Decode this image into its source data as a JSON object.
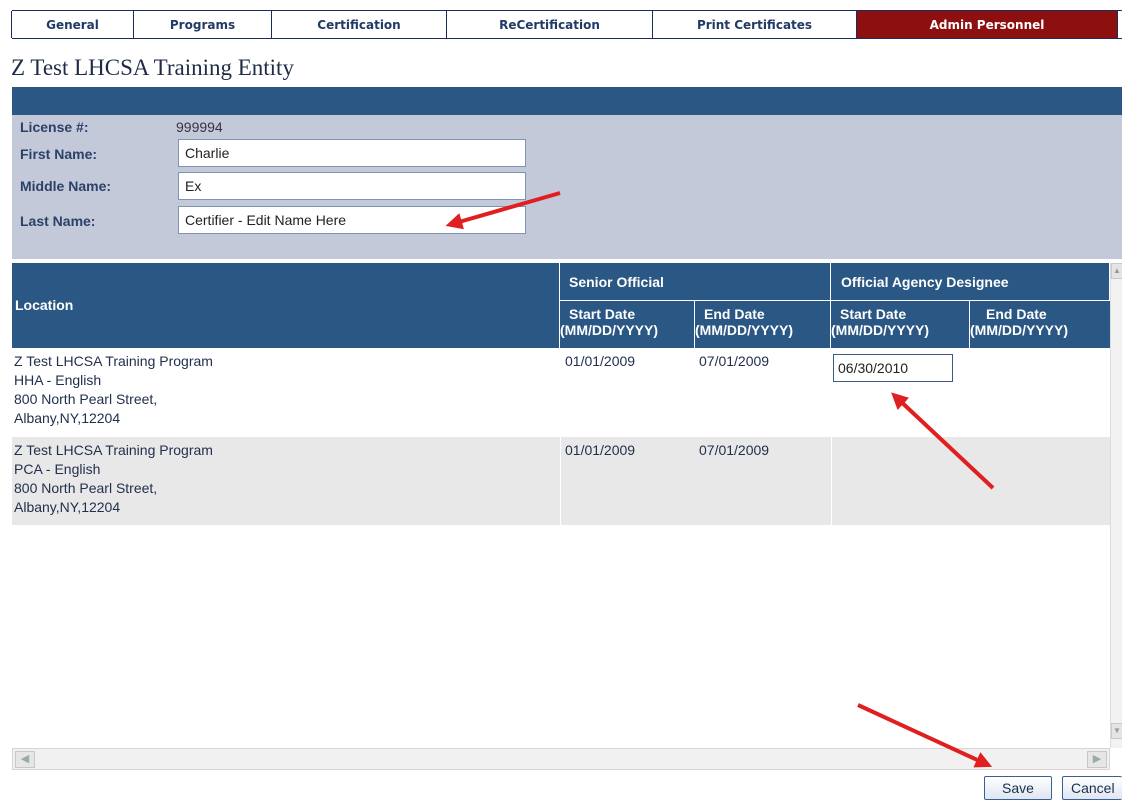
{
  "tabs": [
    {
      "label": "General",
      "active": false
    },
    {
      "label": "Programs",
      "active": false
    },
    {
      "label": "Certification",
      "active": false
    },
    {
      "label": "ReCertification",
      "active": false
    },
    {
      "label": "Print Certificates",
      "active": false
    },
    {
      "label": "Admin Personnel",
      "active": true
    }
  ],
  "page_title": "Z Test LHCSA Training Entity",
  "form": {
    "license_label": "License #:",
    "license_value": "999994",
    "first_name_label": "First Name:",
    "first_name_value": "Charlie",
    "middle_name_label": "Middle Name:",
    "middle_name_value": "Ex",
    "last_name_label": "Last Name:",
    "last_name_value": "Certifier - Edit Name Here"
  },
  "table": {
    "location_header": "Location",
    "senior_official_header": "Senior Official",
    "agency_designee_header": "Official Agency Designee",
    "start_date_header": "Start Date",
    "end_date_header": "End Date",
    "date_format": "(MM/DD/YYYY)",
    "rows": [
      {
        "location": [
          "Z Test LHCSA Training Program",
          "HHA - English",
          "800 North Pearl Street,",
          "Albany,NY,12204"
        ],
        "senior_start": "01/01/2009",
        "senior_end": "07/01/2009",
        "designee_start": "06/30/2010",
        "designee_end": ""
      },
      {
        "location": [
          "Z Test LHCSA Training Program",
          "PCA - English",
          "800 North Pearl Street,",
          "Albany,NY,12204"
        ],
        "senior_start": "01/01/2009",
        "senior_end": "07/01/2009",
        "designee_start": "",
        "designee_end": ""
      }
    ]
  },
  "buttons": {
    "save": "Save",
    "cancel": "Cancel"
  },
  "colors": {
    "header_blue": "#2b5784",
    "active_tab": "#8d0f0f",
    "form_panel": "#c3c9d9",
    "arrow_red": "#e02020"
  },
  "icons": {
    "scroll_left": "arrow-left-icon",
    "scroll_right": "arrow-right-icon",
    "scroll_up": "arrow-up-icon",
    "scroll_down": "arrow-down-icon"
  }
}
